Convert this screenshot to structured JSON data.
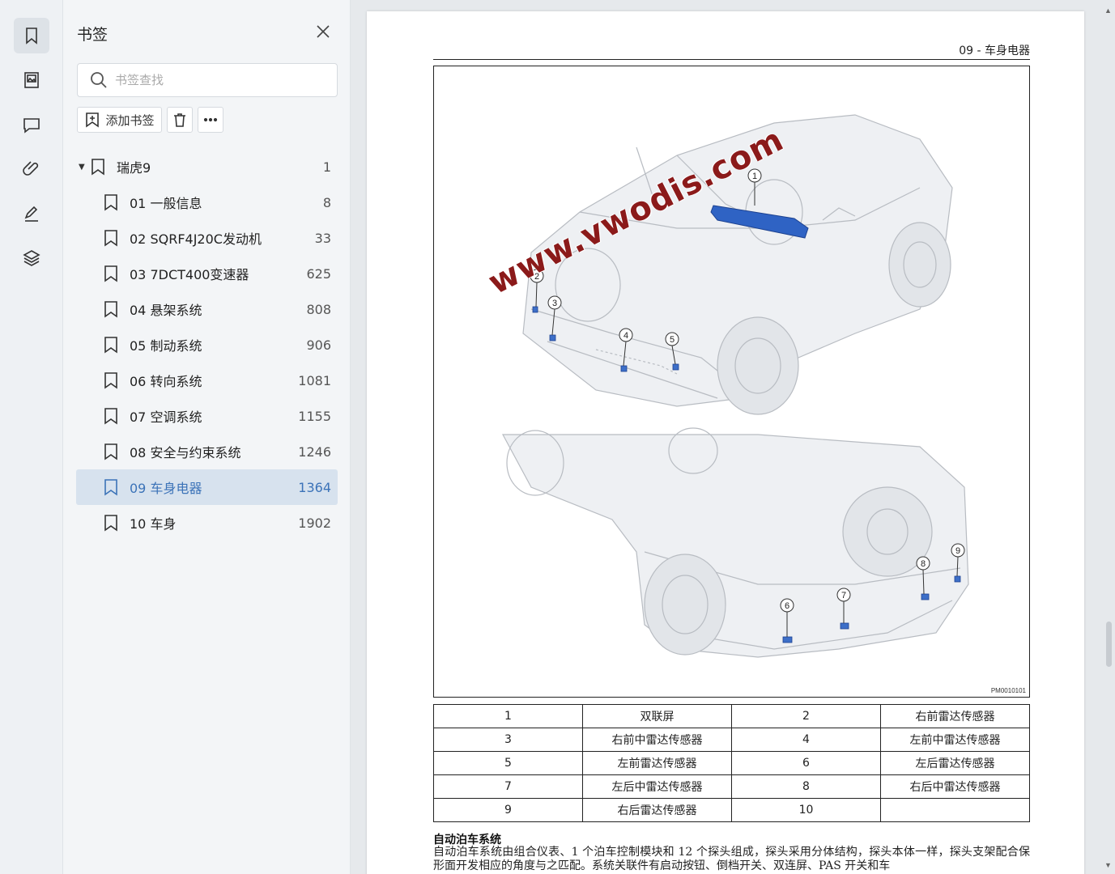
{
  "rail": {
    "items": [
      {
        "icon": "bookmark-icon",
        "active": true
      },
      {
        "icon": "thumbnail-icon",
        "active": false
      },
      {
        "icon": "comment-icon",
        "active": false
      },
      {
        "icon": "attachment-icon",
        "active": false
      },
      {
        "icon": "signature-icon",
        "active": false
      },
      {
        "icon": "layers-icon",
        "active": false
      }
    ]
  },
  "panel": {
    "title": "书签",
    "search_placeholder": "书签查找",
    "add_label": "添加书签"
  },
  "tree": {
    "root": {
      "label": "瑞虎9",
      "page": "1"
    },
    "items": [
      {
        "label": "01 一般信息",
        "page": "8"
      },
      {
        "label": "02 SQRF4J20C发动机",
        "page": "33"
      },
      {
        "label": "03 7DCT400变速器",
        "page": "625"
      },
      {
        "label": "04 悬架系统",
        "page": "808"
      },
      {
        "label": "05 制动系统",
        "page": "906"
      },
      {
        "label": "06 转向系统",
        "page": "1081"
      },
      {
        "label": "07 空调系统",
        "page": "1155"
      },
      {
        "label": "08 安全与约束系统",
        "page": "1246"
      },
      {
        "label": "09 车身电器",
        "page": "1364",
        "selected": true
      },
      {
        "label": "10 车身",
        "page": "1902"
      }
    ]
  },
  "document": {
    "header": "09 - 车身电器",
    "figure_code": "PM0010101",
    "watermark": "www.vwodis.com",
    "callouts": [
      "1",
      "2",
      "3",
      "4",
      "5",
      "6",
      "7",
      "8",
      "9"
    ],
    "legend": [
      [
        "1",
        "双联屏",
        "2",
        "右前雷达传感器"
      ],
      [
        "3",
        "右前中雷达传感器",
        "4",
        "左前中雷达传感器"
      ],
      [
        "5",
        "左前雷达传感器",
        "6",
        "左后雷达传感器"
      ],
      [
        "7",
        "左后中雷达传感器",
        "8",
        "右后中雷达传感器"
      ],
      [
        "9",
        "右后雷达传感器",
        "10",
        ""
      ]
    ],
    "section_title": "自动泊车系统",
    "body": "自动泊车系统由组合仪表、1 个泊车控制模块和 12 个探头组成，探头采用分体结构，探头本体一样，探头支架配合保形面开发相应的角度与之匹配。系统关联件有启动按钮、倒档开关、双连屏、PAS 开关和车"
  },
  "colors": {
    "accent": "#3c73b8",
    "selected_bg": "#d7e2ee",
    "highlight_part": "#2f63c4",
    "watermark": "#8b1a1a"
  }
}
